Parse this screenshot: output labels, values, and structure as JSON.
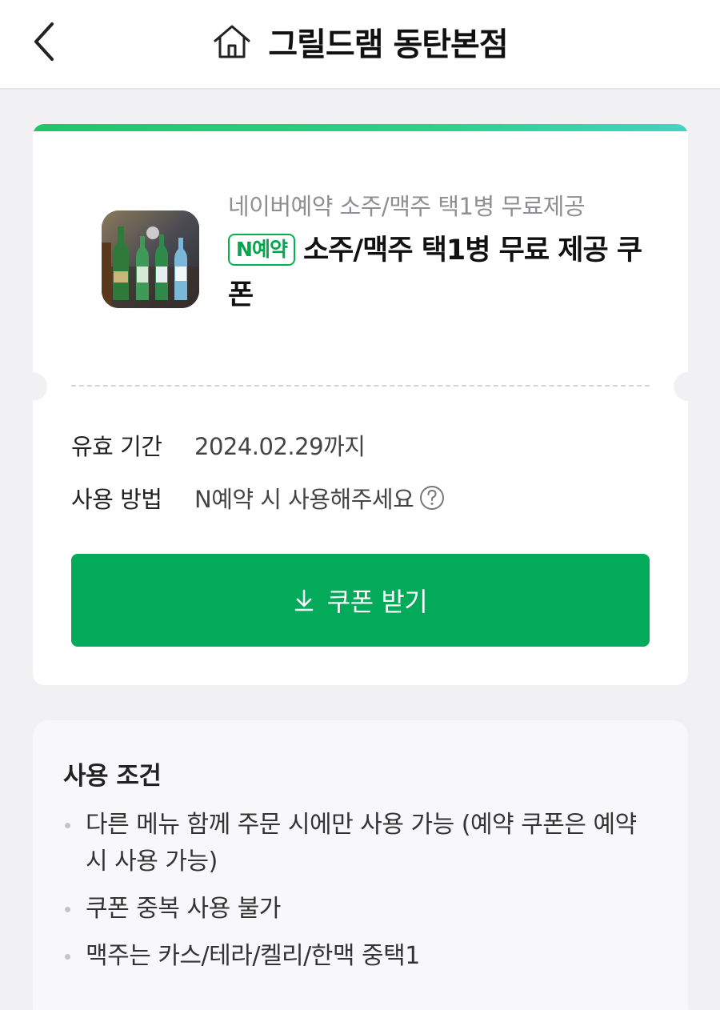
{
  "header": {
    "title": "그릴드램 동탄본점",
    "back_icon": "chevron-left-icon",
    "home_icon": "home-icon"
  },
  "coupon": {
    "accent_gradient": [
      "#1fc66b",
      "#45d3c2"
    ],
    "subtitle": "네이버예약 소주/맥주 택1병 무료제공",
    "badge": {
      "n": "N",
      "text": "예약",
      "color": "#03b153"
    },
    "title": "소주/맥주 택1병 무료 제공 쿠폰",
    "thumbnail_alt": "beer-and-soju-bottles-photo",
    "validity": {
      "label": "유효 기간",
      "value": "2024.02.29까지"
    },
    "usage": {
      "label": "사용 방법",
      "value": "N예약 시 사용해주세요",
      "help_icon": "question-circle-icon"
    },
    "button": {
      "label": "쿠폰 받기",
      "icon": "download-icon",
      "color": "#03aa5a"
    }
  },
  "conditions": {
    "title": "사용 조건",
    "items": [
      "다른 메뉴 함께 주문 시에만 사용 가능 (예약 쿠폰은 예약시 사용 가능)",
      "쿠폰 중복 사용 불가",
      "맥주는 카스/테라/켈리/한맥 중택1"
    ]
  }
}
